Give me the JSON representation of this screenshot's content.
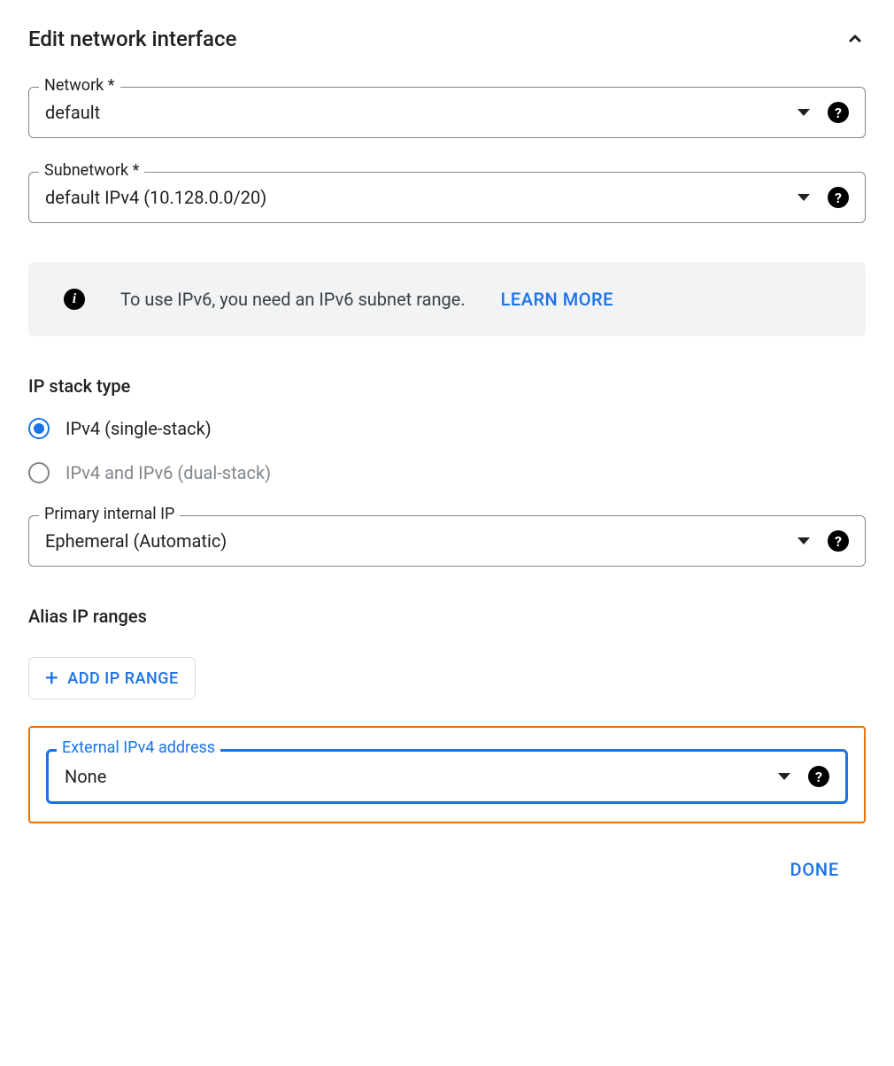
{
  "header": {
    "title": "Edit network interface"
  },
  "fields": {
    "network": {
      "label": "Network *",
      "value": "default"
    },
    "subnetwork": {
      "label": "Subnetwork *",
      "value": "default IPv4 (10.128.0.0/20)"
    },
    "primary_internal_ip": {
      "label": "Primary internal IP",
      "value": "Ephemeral (Automatic)"
    },
    "external_ipv4": {
      "label": "External IPv4 address",
      "value": "None"
    }
  },
  "info_banner": {
    "text": "To use IPv6, you need an IPv6 subnet range.",
    "learn_more": "LEARN MORE"
  },
  "ip_stack": {
    "heading": "IP stack type",
    "option1": "IPv4 (single-stack)",
    "option2": "IPv4 and IPv6 (dual-stack)"
  },
  "alias": {
    "heading": "Alias IP ranges",
    "add_button": "ADD IP RANGE"
  },
  "footer": {
    "done": "DONE"
  }
}
